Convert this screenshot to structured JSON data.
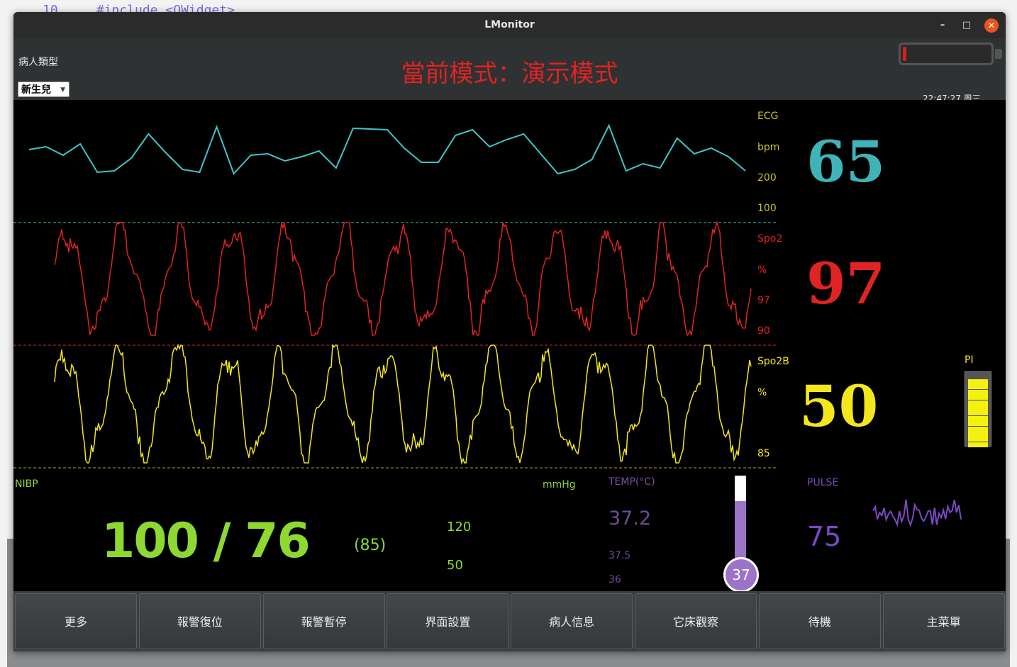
{
  "window": {
    "title": "LMonitor",
    "minimize": "–",
    "maximize": "□",
    "close": "✕"
  },
  "header": {
    "patient_type_label": "病人類型",
    "patient_type_value": "新生兒",
    "mode_title": "當前模式：演示模式",
    "clock": "22:47:27 周三",
    "battery_level": 0.03
  },
  "ecg": {
    "name": "ECG",
    "unit": "bpm",
    "upper": "200",
    "lower": "100",
    "value": "65",
    "color": "#3fc5c7",
    "wave": [
      30,
      34,
      22,
      38,
      -2,
      0,
      18,
      52,
      26,
      2,
      -2,
      62,
      -4,
      22,
      24,
      14,
      20,
      28,
      4,
      60,
      59,
      58,
      32,
      12,
      12,
      50,
      58,
      34,
      44,
      52,
      24,
      -4,
      2,
      16,
      64,
      0,
      10,
      4,
      46,
      24,
      32,
      20,
      0
    ]
  },
  "spo2": {
    "name": "Spo2",
    "unit": "%",
    "upper": "97",
    "lower": "90",
    "value": "97",
    "color": "#e02323"
  },
  "spo2b": {
    "name": "Spo2B",
    "unit": "%",
    "lower": "85",
    "value": "50",
    "color": "#f4e61c"
  },
  "pi": {
    "label": "PI",
    "segments": 13
  },
  "nibp": {
    "name": "NIBP",
    "unit": "mmHg",
    "systolic": "100",
    "separator": "/",
    "diastolic": "76",
    "mean": "(85)",
    "upper": "120",
    "lower": "50",
    "color": "#8ed831"
  },
  "temp": {
    "name": "TEMP(°C)",
    "value": "37.2",
    "upper": "37.5",
    "lower": "36",
    "bulb": "37",
    "level": 0.72,
    "color": "#7a4fa8"
  },
  "pulse": {
    "name": "PULSE",
    "value": "75",
    "color": "#7b48c4"
  },
  "menu": [
    "更多",
    "報警復位",
    "報警暫停",
    "界面設置",
    "病人信息",
    "它床觀察",
    "待機",
    "主菜單"
  ]
}
